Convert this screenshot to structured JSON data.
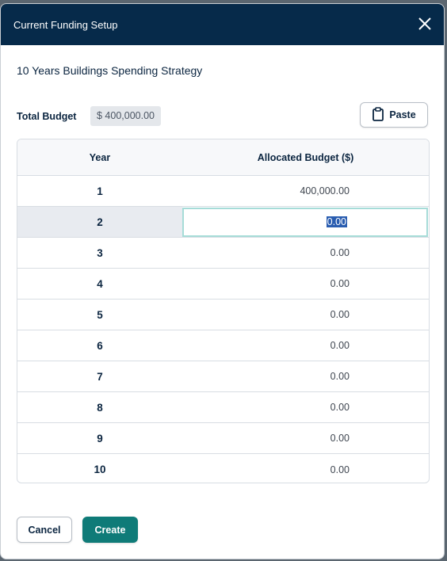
{
  "dialog": {
    "title": "Current Funding Setup",
    "close_icon": "close-icon"
  },
  "strategy_name": "10 Years Buildings Spending Strategy",
  "total_budget": {
    "label": "Total Budget",
    "value": "$ 400,000.00"
  },
  "paste_button": {
    "label": "Paste",
    "icon": "clipboard-icon"
  },
  "table": {
    "headers": [
      "Year",
      "Allocated Budget ($)"
    ],
    "rows": [
      {
        "year": "1",
        "budget": "400,000.00"
      },
      {
        "year": "2",
        "budget": "0.00"
      },
      {
        "year": "3",
        "budget": "0.00"
      },
      {
        "year": "4",
        "budget": "0.00"
      },
      {
        "year": "5",
        "budget": "0.00"
      },
      {
        "year": "6",
        "budget": "0.00"
      },
      {
        "year": "7",
        "budget": "0.00"
      },
      {
        "year": "8",
        "budget": "0.00"
      },
      {
        "year": "9",
        "budget": "0.00"
      },
      {
        "year": "10",
        "budget": "0.00"
      }
    ],
    "active_row_index": 1
  },
  "footer": {
    "cancel_label": "Cancel",
    "create_label": "Create"
  },
  "colors": {
    "header_bg": "#062a4a",
    "accent": "#0f7b78",
    "edit_border": "#a6dcd8"
  }
}
